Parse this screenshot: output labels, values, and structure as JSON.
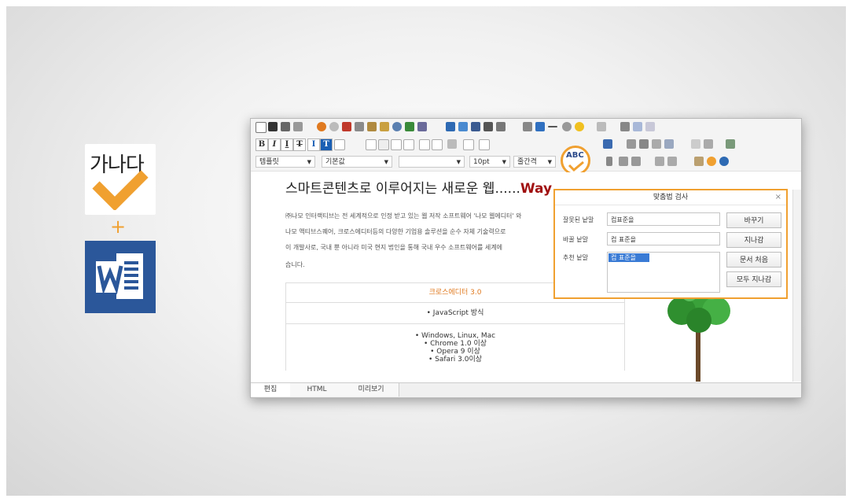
{
  "promo": {
    "text": "가나다",
    "plus": "+"
  },
  "editor": {
    "format_buttons": [
      "B",
      "I",
      "I",
      "T",
      "I",
      "T"
    ],
    "style_select": "템플릿",
    "font_select": "기본값",
    "size_select": "10pt",
    "spacing_select": "줄간격",
    "abc_badge": "ABC",
    "heading": "스마트콘텐츠로 이루어지는 새로운 웹......",
    "heading_highlight": "Way",
    "paragraph": [
      "㈜나모 인터랙티브는 전 세계적으로 인정 받고 있는 웹 저작 소프트웨어 '나모 웹에디터' 와",
      "나모 액티브스퀘어, 크로스에디터등의 다양한 기업용 솔루션을 순수 자체 기술력으로",
      "이 개발사로, 국내 뿐 아니라 미국 현지 법인을 통해 국내 우수 소프트웨어를 세계에",
      "습니다."
    ],
    "table_rows": [
      "크로스에디터 3.0",
      "• JavaScript 방식",
      "• Windows, Linux, Mac",
      "• Chrome 1.0 이상",
      "• Opera 9 이상",
      "• Safari 3.0이상"
    ],
    "tabs": [
      "편집",
      "HTML",
      "미리보기"
    ]
  },
  "spellcheck": {
    "title": "맞춤법 검사",
    "close": "×",
    "wrong_label": "잘못된 낱말",
    "wrong_value": "컵표준을",
    "change_label": "바꿀 낱말",
    "change_value": "컵 표준을",
    "suggest_label": "추천 낱말",
    "suggest_value": "컵 표준을",
    "btn_change": "바꾸기",
    "btn_skip": "지나감",
    "btn_doc_start": "문서 처음",
    "btn_skip_all": "모두 지나감"
  },
  "colors": {
    "accent": "#f0a030",
    "word_blue": "#2b579a",
    "heading_red": "#a01010",
    "selection": "#3a7bd5"
  }
}
